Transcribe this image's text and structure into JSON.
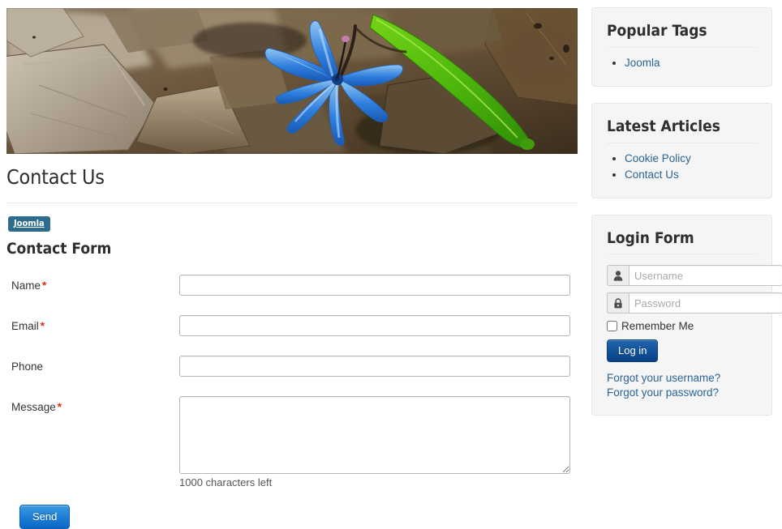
{
  "main": {
    "hero": {
      "alt": "blue-scilla-flower-on-forest-floor-leaves"
    },
    "page_title": "Contact Us",
    "tags": [
      {
        "label": "Joomla"
      }
    ],
    "form_title": "Contact Form",
    "fields": [
      {
        "label": "Name",
        "required": true,
        "value": "",
        "placeholder": ""
      },
      {
        "label": "Email",
        "required": true,
        "value": "",
        "placeholder": ""
      },
      {
        "label": "Phone",
        "required": false,
        "value": "",
        "placeholder": ""
      },
      {
        "label": "Message",
        "required": true,
        "value": "",
        "placeholder": ""
      }
    ],
    "required_marker": "*",
    "char_counter": "1000 characters left",
    "send_label": "Send"
  },
  "sidebar": {
    "modules": [
      {
        "title": "Popular Tags",
        "items": [
          {
            "label": "Joomla"
          }
        ]
      },
      {
        "title": "Latest Articles",
        "items": [
          {
            "label": "Cookie Policy"
          },
          {
            "label": "Contact Us"
          }
        ]
      }
    ],
    "login": {
      "title": "Login Form",
      "username_placeholder": "Username",
      "password_placeholder": "Password",
      "username_value": "",
      "password_value": "",
      "remember_label": "Remember Me",
      "submit_label": "Log in",
      "forgot_username": "Forgot your username?",
      "forgot_password": "Forgot your password?",
      "user_icon": "user-icon",
      "lock_icon": "lock-icon"
    }
  },
  "colors": {
    "tag_badge": "#2e6c8e",
    "link": "#2a6496",
    "required_star": "#e32b18",
    "send_button": "#1f7ed4",
    "login_button": "#13539a",
    "module_bg": "#f5f5f5"
  }
}
